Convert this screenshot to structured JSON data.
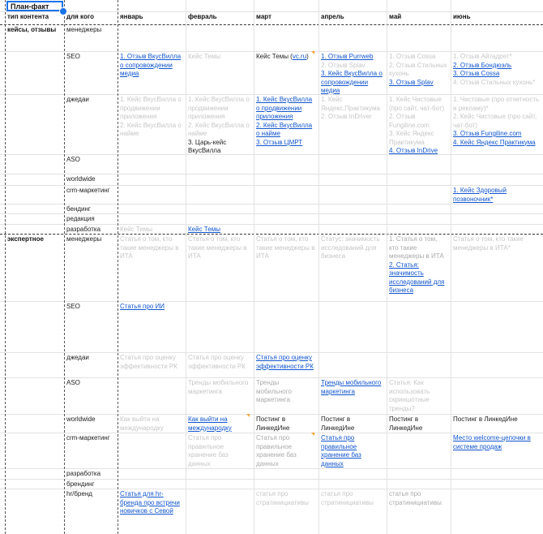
{
  "title": "План-факт",
  "headers": [
    "тип контента",
    "для кого",
    "январь",
    "февраль",
    "март",
    "апрель",
    "май",
    "июнь"
  ],
  "sections": {
    "cases": "кейсы, отзывы",
    "expert": "экспертное"
  },
  "rows": [
    {
      "label": "менеджеры",
      "c": [
        [],
        [],
        [],
        [],
        [],
        []
      ]
    },
    {
      "label": "SEO",
      "c": [
        [
          {
            "t": "1. Отзыв ВкусВилла о сопровождении медиа",
            "l": 1
          }
        ],
        [
          {
            "t": "Кейс Темы",
            "d": 1
          }
        ],
        [
          {
            "t": "Кейс Темы ("
          },
          {
            "t": "vc.ru",
            "l": 1,
            "i": 1
          },
          {
            "t": ")",
            "i": 1
          }
        ],
        [
          {
            "t": "1. Отзыв Purrweb",
            "l": 1
          },
          {
            "t": "2. Отзыв Splav",
            "d": 1
          },
          {
            "t": "3. Кейс ВкусВилла о сопровождении медиа",
            "l": 1
          }
        ],
        [
          {
            "t": "1. Отзыв Cossa",
            "d": 1
          },
          {
            "t": "2. Отзыв Стильных кухонь",
            "d": 1
          },
          {
            "t": "3. Отзыв Splav",
            "l": 1
          }
        ],
        [
          {
            "t": "1. Отзыв Айтадрет*",
            "d": 1
          },
          {
            "t": "2. Отзыв Бондюэль",
            "l": 1
          },
          {
            "t": "3. Отзыв Cossa",
            "l": 1
          },
          {
            "t": "4. Отзыв Стильных кухонь*",
            "d": 1
          }
        ]
      ]
    },
    {
      "label": "джедаи",
      "c": [
        [
          {
            "t": "1. Кейс ВкусВилла о продвижении приложения",
            "d": 1
          },
          {
            "t": "2. Кейс ВкусВилла о найме",
            "d": 1
          }
        ],
        [
          {
            "t": "1. Кейс ВкусВилла о продвижении приложения",
            "d": 1
          },
          {
            "t": "2. Кейс ВкусВилла о найме",
            "d": 1
          },
          {
            "t": "3. Царь-кейс ВкусВилла"
          }
        ],
        [
          {
            "t": "1. Кейс ВкусВилла о продвижении приложения",
            "l": 1
          },
          {
            "t": "2. Кейс ВкусВилла о найме",
            "l": 1
          },
          {
            "t": "3. Отзыв ЦМРТ",
            "l": 1
          }
        ],
        [
          {
            "t": "1. Кейс Яндекс.Практикума",
            "d": 1
          },
          {
            "t": "2. Отзыв InDriver",
            "d": 1
          }
        ],
        [
          {
            "t": "1. Кейс Чистовые (про сайт, чат-бот)",
            "d": 1
          },
          {
            "t": "2. Отзыв Fungiline.com",
            "d": 1
          },
          {
            "t": "3. Кейс Яндекс Практикума",
            "d": 1
          },
          {
            "t": "4. Отзыв InDrive",
            "l": 1
          }
        ],
        [
          {
            "t": "1. Чистовые (про отчетность и рекламу)*",
            "d": 1
          },
          {
            "t": "2. Кейс Чистовые (про сайт, чат-бот)",
            "d": 1
          },
          {
            "t": "3. Отзыв Fungiline.com",
            "l": 1
          },
          {
            "t": "4. Кейс Яндекс Практикума",
            "l": 1
          }
        ]
      ]
    },
    {
      "label": "ASO",
      "c": [
        [],
        [],
        [],
        [],
        [],
        []
      ]
    },
    {
      "label": "worldwide",
      "c": [
        [],
        [],
        [],
        [],
        [],
        []
      ]
    },
    {
      "label": "crm-маркетинг",
      "c": [
        [],
        [],
        [],
        [],
        [],
        [
          {
            "t": "1. Кейс Здоровый позвоночник*",
            "l": 1
          }
        ]
      ]
    },
    {
      "label": "бендинг",
      "c": [
        [],
        [],
        [],
        [],
        [],
        []
      ]
    },
    {
      "label": "редакция",
      "c": [
        [],
        [],
        [],
        [],
        [],
        []
      ]
    },
    {
      "label": "разработка",
      "c": [
        [
          {
            "t": "Кейс Темы",
            "d": 1
          }
        ],
        [
          {
            "t": "Кейс Темы",
            "l": 1
          }
        ],
        [],
        [],
        [],
        []
      ]
    },
    {
      "label": "менеджеры",
      "c": [
        [
          {
            "t": "Статья о том, кто такие менеджеры в ИТА",
            "d": 1
          }
        ],
        [
          {
            "t": "Статья о том, кто такие менеджеры в ИТА",
            "d": 1
          }
        ],
        [
          {
            "t": "Статья о том, кто такие менеджеры в ИТА",
            "d": 1
          }
        ],
        [
          {
            "t": "Статус: значимость исследований для бизнеса",
            "d": 1
          }
        ],
        [
          {
            "t": "1. Статья о том, кто такие менеджеры в ИТА",
            "m": 1
          },
          {
            "t": " ",
            "m": 1
          },
          {
            "t": "2. Статья: значимость исследований для бизнеса",
            "l": 1
          }
        ],
        [
          {
            "t": "Статья о том, кто такие менеджеры в ИТА*",
            "d": 1
          }
        ]
      ]
    },
    {
      "label": "SEO",
      "c": [
        [
          {
            "t": "Статья про ИИ",
            "l": 1
          }
        ],
        [],
        [],
        [],
        [],
        []
      ]
    },
    {
      "label": "джедаи",
      "c": [
        [
          {
            "t": "Статья про оценку эффективности РК",
            "d": 1
          }
        ],
        [
          {
            "t": "Статья про оценку эффективности РК",
            "d": 1
          }
        ],
        [
          {
            "t": "Статья про оценку эффективности РК",
            "l": 1
          }
        ],
        [],
        [],
        []
      ]
    },
    {
      "label": "ASO",
      "c": [
        [],
        [
          {
            "t": "Тренды мобильного маркетинга",
            "d": 1
          }
        ],
        [
          {
            "t": "Тренды мобильного маркетинга",
            "m": 1
          }
        ],
        [
          {
            "t": "Тренды мобильного маркетинга",
            "l": 1
          }
        ],
        [
          {
            "t": "Статья: Как использовать скриншотные тренды?",
            "d": 1
          }
        ],
        []
      ]
    },
    {
      "label": "worldwide",
      "c": [
        [
          {
            "t": "Как выйти на международку",
            "d": 1
          }
        ],
        [
          {
            "t": "Как выйти на международку",
            "l": 1
          }
        ],
        [
          {
            "t": "Постинг в ЛинкедИне"
          }
        ],
        [
          {
            "t": "Постинг в ЛинкедИне"
          }
        ],
        [
          {
            "t": "Постинг в ЛинкедИне"
          }
        ],
        [
          {
            "t": "Постинг в ЛинкедИне"
          }
        ]
      ]
    },
    {
      "label": "crm-маркетинг",
      "c": [
        [],
        [
          {
            "t": "Статья про правильное хранение баз данных",
            "d": 1
          }
        ],
        [
          {
            "t": "Статья про правильное хранение баз данных",
            "m": 1
          }
        ],
        [
          {
            "t": "Статья про правильное хранение баз данных",
            "l": 1
          }
        ],
        [],
        [
          {
            "t": " "
          },
          {
            "t": " "
          },
          {
            "t": "Место welcome-цепочки в системе продаж",
            "l": 1
          }
        ]
      ]
    },
    {
      "label": "разработка",
      "c": [
        [],
        [],
        [],
        [],
        [],
        []
      ]
    },
    {
      "label": "брендинг",
      "c": [
        [],
        [],
        [],
        [],
        [],
        []
      ]
    },
    {
      "label": "hr/бренд",
      "c": [
        [
          {
            "t": "Статья для hr-бренда про встречи новичков с Севой",
            "l": 1
          }
        ],
        [],
        [
          {
            "t": "статья про стратинициативы",
            "d": 1
          }
        ],
        [
          {
            "t": "статья про стратинициативы",
            "d": 1
          }
        ],
        [
          {
            "t": "статья про стратинициативы",
            "m": 1
          }
        ],
        []
      ]
    }
  ]
}
